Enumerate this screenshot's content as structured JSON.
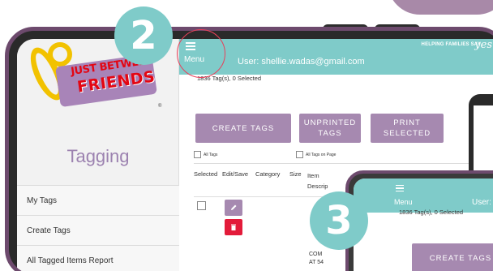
{
  "app": {
    "logo_line1": "JUST BETWEEN",
    "logo_line2": "FRIENDS",
    "logo_reg": "®",
    "brand_tagline": "HELPING FAMILIES SAY",
    "brand_yes": "yes"
  },
  "sidebar": {
    "title": "Tagging",
    "items": [
      {
        "label": "My Tags"
      },
      {
        "label": "Create Tags"
      },
      {
        "label": "All Tagged Items Report"
      }
    ]
  },
  "header": {
    "menu_label": "Menu",
    "user_label": "User: shellie.wadas@gmail.com"
  },
  "main": {
    "count_label": "1836 Tag(s), 0 Selected",
    "buttons": {
      "create": "CREATE TAGS",
      "unprinted_l1": "UNPRINTED",
      "unprinted_l2": "TAGS",
      "print_l1": "PRINT",
      "print_l2": "SELECTED"
    },
    "checkbox_all_tags": "All Tags",
    "checkbox_all_tags_page": "All Tags on Page",
    "table": {
      "headers": [
        "Selected",
        "Edit/Save",
        "Category",
        "Size",
        "Item Descrip"
      ],
      "row_text_1": "COM",
      "row_text_2": "AT 54"
    }
  },
  "steps": {
    "step2": "2",
    "step3": "3"
  },
  "phone": {
    "menu_label": "Menu",
    "user_label": "User:",
    "count_label": "1836 Tag(s), 0 Selected",
    "create_button": "CREATE TAGS"
  },
  "colors": {
    "teal": "#7fcbc9",
    "purple": "#a689b0",
    "frame": "#6d4a6d",
    "delete": "#e31b3a"
  }
}
